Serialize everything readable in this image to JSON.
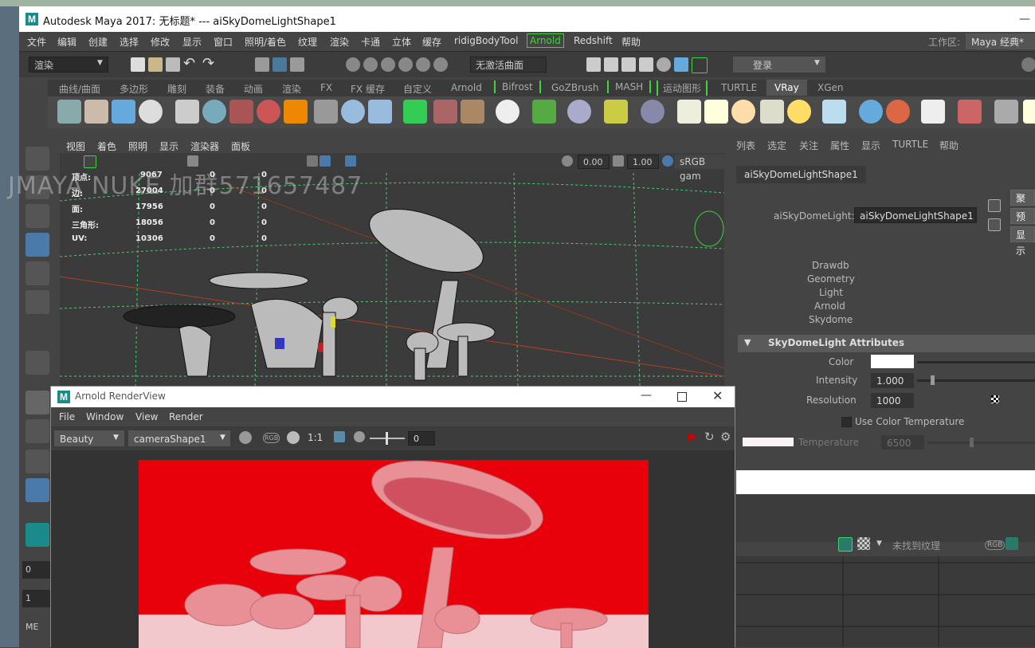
{
  "window": {
    "title": "Autodesk Maya 2017: 无标题*   ---   aiSkyDomeLightShape1",
    "logo": "M"
  },
  "menus": [
    "文件",
    "编辑",
    "创建",
    "选择",
    "修改",
    "显示",
    "窗口",
    "照明/着色",
    "纹理",
    "渲染",
    "卡通",
    "立体",
    "缓存",
    "ridigBodyTool",
    "Arnold",
    "Redshift",
    "帮助"
  ],
  "workspace": {
    "label": "工作区:",
    "value": "Maya 经典*"
  },
  "status": {
    "mode": "渲染",
    "live_surface": "无激活曲面",
    "login": "登录"
  },
  "shelf_tabs": [
    "曲线/曲面",
    "多边形",
    "雕刻",
    "装备",
    "动画",
    "渲染",
    "FX",
    "FX 缓存",
    "自定义",
    "Arnold",
    "Bifrost",
    "GoZBrush",
    "MASH",
    "运动图形",
    "TURTLE",
    "VRay",
    "XGen"
  ],
  "shelf_active": "VRay",
  "viewport": {
    "menus": [
      "视图",
      "着色",
      "照明",
      "显示",
      "渲染器",
      "面板"
    ],
    "exposure": "0.00",
    "gamma": "1.00",
    "colorspace": "sRGB gam",
    "hud": [
      {
        "label": "顶点:",
        "v1": "9067",
        "v2": "0",
        "v3": "0"
      },
      {
        "label": "边:",
        "v1": "27004",
        "v2": "0",
        "v3": "0"
      },
      {
        "label": "面:",
        "v1": "17956",
        "v2": "0",
        "v3": "0"
      },
      {
        "label": "三角形:",
        "v1": "18056",
        "v2": "0",
        "v3": "0"
      },
      {
        "label": "UV:",
        "v1": "10306",
        "v2": "0",
        "v3": "0"
      }
    ]
  },
  "watermark": "JMAYA NUKE 加群571657487",
  "attribute_editor": {
    "menus": [
      "列表",
      "选定",
      "关注",
      "属性",
      "显示",
      "TURTLE",
      "帮助"
    ],
    "tab": "aiSkyDomeLightShape1",
    "node_label": "aiSkyDomeLight:",
    "node_value": "aiSkyDomeLightShape1",
    "side_buttons": [
      "聚",
      "预",
      "显示"
    ],
    "classifications": [
      "Drawdb",
      "Geometry",
      "Light",
      "Arnold",
      "Skydome"
    ],
    "section": "SkyDomeLight Attributes",
    "color_label": "Color",
    "intensity_label": "Intensity",
    "intensity": "1.000",
    "resolution_label": "Resolution",
    "resolution": "1000",
    "use_color_temp": "Use Color Temperature",
    "temperature_label": "Temperature",
    "temperature": "6500",
    "texture_status": "未找到纹理",
    "rgb": "RGB"
  },
  "render_view": {
    "title": "Arnold RenderView",
    "menus": [
      "File",
      "Window",
      "View",
      "Render"
    ],
    "aov": "Beauty",
    "camera": "cameraShape1",
    "rgb": "RGB",
    "ratio": "1:1",
    "frame": "0"
  },
  "left_fields": [
    "0",
    "1",
    "ME"
  ],
  "colors": {
    "accent_green": "#3fd23f",
    "render_bg": "#e8000a",
    "shelf_active": "#555555"
  }
}
